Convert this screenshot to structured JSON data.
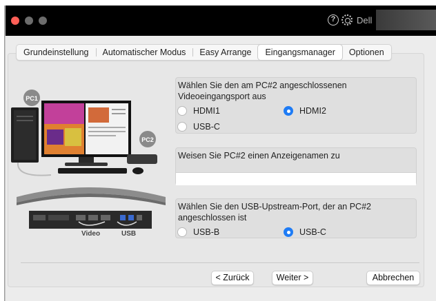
{
  "titlebar": {
    "brand": "Dell"
  },
  "tabs": [
    {
      "label": "Grundeinstellung",
      "active": false
    },
    {
      "label": "Automatischer Modus",
      "active": false
    },
    {
      "label": "Easy Arrange",
      "active": false
    },
    {
      "label": "Eingangsmanager",
      "active": true
    },
    {
      "label": "Optionen",
      "active": false
    }
  ],
  "illustration": {
    "pc1_badge": "PC1",
    "pc2_badge": "PC2",
    "video_label": "Video",
    "usb_label": "USB"
  },
  "video_port": {
    "question": "Wählen Sie den am PC#2 angeschlossenen Videoeingangsport aus",
    "options": [
      "HDMI1",
      "HDMI2",
      "USB-C"
    ],
    "selected": "HDMI2"
  },
  "display_name": {
    "question": "Weisen Sie PC#2 einen Anzeigenamen zu",
    "value": ""
  },
  "usb_port": {
    "question": "Wählen Sie den USB-Upstream-Port, der an PC#2 angeschlossen ist",
    "options": [
      "USB-B",
      "USB-C"
    ],
    "selected": "USB-C"
  },
  "buttons": {
    "back": "< Zurück",
    "next": "Weiter >",
    "cancel": "Abbrechen"
  },
  "colors": {
    "accent": "#1f7cf5",
    "close": "#ff5f57",
    "titlebar": "#000000"
  }
}
